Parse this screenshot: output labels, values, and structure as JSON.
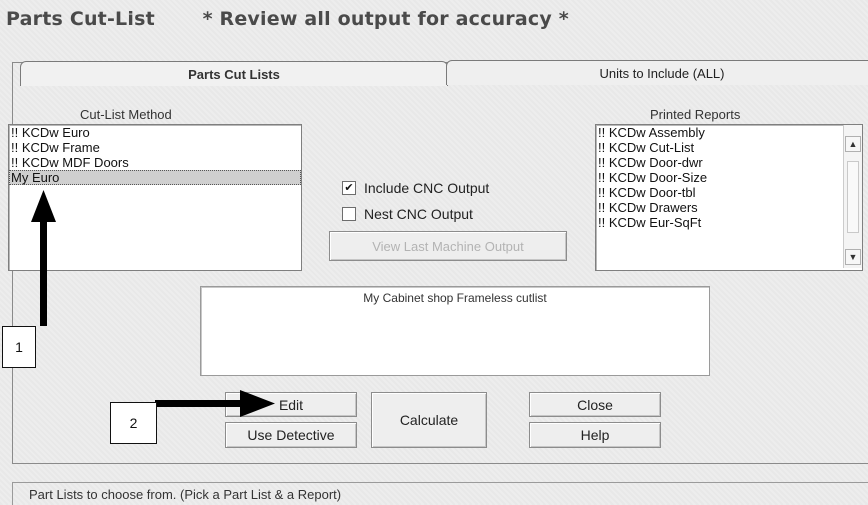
{
  "title": "Parts Cut-List       * Review all output for accuracy *",
  "tabs": [
    {
      "label": "Parts Cut Lists"
    },
    {
      "label": "Units to Include (ALL)"
    }
  ],
  "cut_list_method": {
    "label": "Cut-List Method",
    "items": [
      "!! KCDw Euro",
      "!! KCDw Frame",
      "!! KCDw MDF Doors",
      "My Euro"
    ],
    "selected": "My Euro"
  },
  "options": {
    "include_cnc": {
      "label": "Include CNC Output",
      "checked": true
    },
    "nest_cnc": {
      "label": "Nest CNC Output",
      "checked": false
    },
    "view_last_label": "View Last Machine Output"
  },
  "printed_reports": {
    "label": "Printed Reports",
    "items": [
      "!! KCDw Assembly",
      "!! KCDw Cut-List",
      "!! KCDw Door-dwr",
      "!! KCDw Door-Size",
      "!! KCDw Door-tbl",
      "!! KCDw Drawers",
      "!! KCDw Eur-SqFt"
    ]
  },
  "description": "My Cabinet shop Frameless cutlist",
  "buttons": {
    "edit": "Edit",
    "use_detective": "Use Detective",
    "calculate": "Calculate",
    "close": "Close",
    "help": "Help"
  },
  "callouts": {
    "one": "1",
    "two": "2"
  },
  "status_text": "Part Lists to choose from. (Pick a Part List & a Report)",
  "scroll_icons": {
    "up": "chevron-up-icon",
    "down": "chevron-down-icon"
  }
}
